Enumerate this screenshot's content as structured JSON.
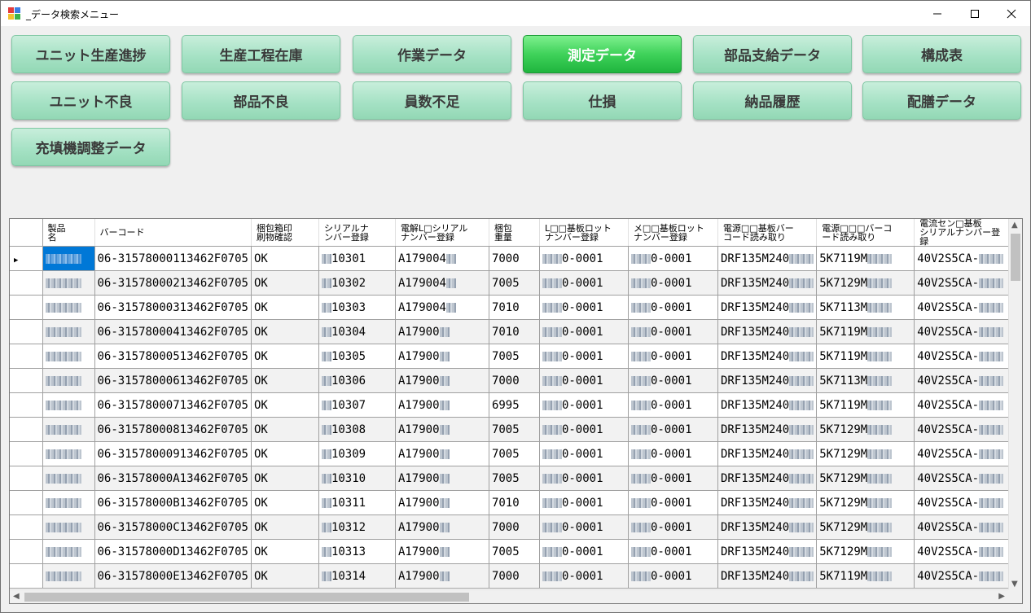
{
  "window": {
    "title": "_データ検索メニュー"
  },
  "buttons": [
    {
      "label": "ユニット生産進捗",
      "active": false
    },
    {
      "label": "生産工程在庫",
      "active": false
    },
    {
      "label": "作業データ",
      "active": false
    },
    {
      "label": "測定データ",
      "active": true
    },
    {
      "label": "部品支給データ",
      "active": false
    },
    {
      "label": "構成表",
      "active": false
    },
    {
      "label": "ユニット不良",
      "active": false
    },
    {
      "label": "部品不良",
      "active": false
    },
    {
      "label": "員数不足",
      "active": false
    },
    {
      "label": "仕損",
      "active": false
    },
    {
      "label": "納品履歴",
      "active": false
    },
    {
      "label": "配膳データ",
      "active": false
    },
    {
      "label": "充填機調整データ",
      "active": false
    }
  ],
  "grid": {
    "columns": [
      "製品\n名",
      "バーコード",
      "梱包箱印\n刷物確認",
      "シリアルナ\nンバー登録",
      "電解L□シリアル\nナンバー登録",
      "梱包\n重量",
      "L□□基板ロット\nナンバー登録",
      "メ□□基板ロット\nナンバー登録",
      "電源□□基板バー\nコード読み取り",
      "電源□□□バーコ\nード読み取り",
      "電流セン□基板\nシリアルナンバー登録"
    ],
    "rows": [
      {
        "barcode": "06-31578000113462F0705",
        "check": "OK",
        "serial": "10301",
        "elec": "A179004",
        "weight": "7000",
        "lot1": "0-0001",
        "lot2": "0-0001",
        "psu1": "DRF135M240",
        "psu2": "5K7119M",
        "cur": "40V2S5CA-"
      },
      {
        "barcode": "06-31578000213462F0705",
        "check": "OK",
        "serial": "10302",
        "elec": "A179004",
        "weight": "7005",
        "lot1": "0-0001",
        "lot2": "0-0001",
        "psu1": "DRF135M240",
        "psu2": "5K7129M",
        "cur": "40V2S5CA-"
      },
      {
        "barcode": "06-31578000313462F0705",
        "check": "OK",
        "serial": "10303",
        "elec": "A179004",
        "weight": "7010",
        "lot1": "0-0001",
        "lot2": "0-0001",
        "psu1": "DRF135M240",
        "psu2": "5K7113M",
        "cur": "40V2S5CA-"
      },
      {
        "barcode": "06-31578000413462F0705",
        "check": "OK",
        "serial": "10304",
        "elec": "A17900",
        "weight": "7010",
        "lot1": "0-0001",
        "lot2": "0-0001",
        "psu1": "DRF135M240",
        "psu2": "5K7119M",
        "cur": "40V2S5CA-"
      },
      {
        "barcode": "06-31578000513462F0705",
        "check": "OK",
        "serial": "10305",
        "elec": "A17900",
        "weight": "7005",
        "lot1": "0-0001",
        "lot2": "0-0001",
        "psu1": "DRF135M240",
        "psu2": "5K7119M",
        "cur": "40V2S5CA-"
      },
      {
        "barcode": "06-31578000613462F0705",
        "check": "OK",
        "serial": "10306",
        "elec": "A17900",
        "weight": "7000",
        "lot1": "0-0001",
        "lot2": "0-0001",
        "psu1": "DRF135M240",
        "psu2": "5K7113M",
        "cur": "40V2S5CA-"
      },
      {
        "barcode": "06-31578000713462F0705",
        "check": "OK",
        "serial": "10307",
        "elec": "A17900",
        "weight": "6995",
        "lot1": "0-0001",
        "lot2": "0-0001",
        "psu1": "DRF135M240",
        "psu2": "5K7119M",
        "cur": "40V2S5CA-"
      },
      {
        "barcode": "06-31578000813462F0705",
        "check": "OK",
        "serial": "10308",
        "elec": "A17900",
        "weight": "7005",
        "lot1": "0-0001",
        "lot2": "0-0001",
        "psu1": "DRF135M240",
        "psu2": "5K7129M",
        "cur": "40V2S5CA-"
      },
      {
        "barcode": "06-31578000913462F0705",
        "check": "OK",
        "serial": "10309",
        "elec": "A17900",
        "weight": "7005",
        "lot1": "0-0001",
        "lot2": "0-0001",
        "psu1": "DRF135M240",
        "psu2": "5K7129M",
        "cur": "40V2S5CA-"
      },
      {
        "barcode": "06-31578000A13462F0705",
        "check": "OK",
        "serial": "10310",
        "elec": "A17900",
        "weight": "7005",
        "lot1": "0-0001",
        "lot2": "0-0001",
        "psu1": "DRF135M240",
        "psu2": "5K7129M",
        "cur": "40V2S5CA-"
      },
      {
        "barcode": "06-31578000B13462F0705",
        "check": "OK",
        "serial": "10311",
        "elec": "A17900",
        "weight": "7010",
        "lot1": "0-0001",
        "lot2": "0-0001",
        "psu1": "DRF135M240",
        "psu2": "5K7129M",
        "cur": "40V2S5CA-"
      },
      {
        "barcode": "06-31578000C13462F0705",
        "check": "OK",
        "serial": "10312",
        "elec": "A17900",
        "weight": "7000",
        "lot1": "0-0001",
        "lot2": "0-0001",
        "psu1": "DRF135M240",
        "psu2": "5K7129M",
        "cur": "40V2S5CA-"
      },
      {
        "barcode": "06-31578000D13462F0705",
        "check": "OK",
        "serial": "10313",
        "elec": "A17900",
        "weight": "7005",
        "lot1": "0-0001",
        "lot2": "0-0001",
        "psu1": "DRF135M240",
        "psu2": "5K7129M",
        "cur": "40V2S5CA-"
      },
      {
        "barcode": "06-31578000E13462F0705",
        "check": "OK",
        "serial": "10314",
        "elec": "A17900",
        "weight": "7000",
        "lot1": "0-0001",
        "lot2": "0-0001",
        "psu1": "DRF135M240",
        "psu2": "5K7119M",
        "cur": "40V2S5CA-"
      }
    ],
    "selected_row": 0
  },
  "colors": {
    "active_button": "#3fd25a",
    "button": "#a6e2c5",
    "selection": "#0078d7"
  },
  "icons": [
    "app-icon",
    "minimize-icon",
    "maximize-icon",
    "close-icon",
    "row-indicator-icon",
    "scroll-up-icon",
    "scroll-down-icon",
    "scroll-left-icon",
    "scroll-right-icon"
  ]
}
